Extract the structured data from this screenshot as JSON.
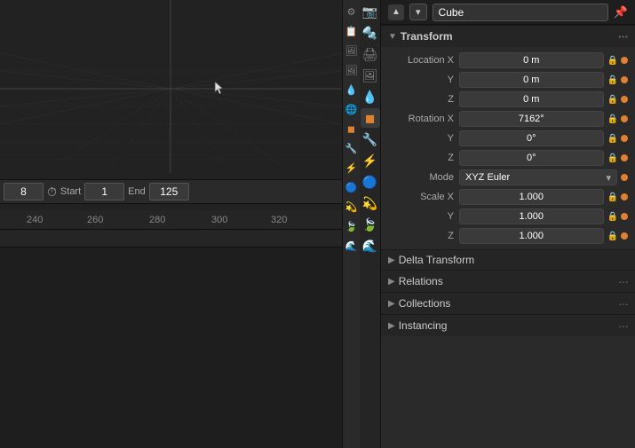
{
  "viewport": {
    "frame_current": "8",
    "timeline_start_label": "Start",
    "timeline_start_value": "1",
    "timeline_end_label": "End",
    "timeline_end_value": "125",
    "ruler_marks": [
      "240",
      "260",
      "280",
      "300",
      "320"
    ]
  },
  "properties": {
    "header": {
      "type_label": "Cube",
      "name_value": "Cube",
      "pin_symbol": "📌"
    },
    "transform_section": {
      "label": "Transform",
      "dots": "···"
    },
    "location": {
      "label_x": "Location X",
      "label_y": "Y",
      "label_z": "Z",
      "value_x": "0 m",
      "value_y": "0 m",
      "value_z": "0 m"
    },
    "rotation": {
      "label_x": "Rotation X",
      "label_y": "Y",
      "label_z": "Z",
      "value_x": "7162°",
      "value_y": "0°",
      "value_z": "0°",
      "mode_label": "Mode",
      "mode_value": "XYZ Euler",
      "mode_dots": "···"
    },
    "scale": {
      "label_x": "Scale X",
      "label_y": "Y",
      "label_z": "Z",
      "value_x": "1.000",
      "value_y": "1.000",
      "value_z": "1.000"
    },
    "delta_section": {
      "label": "Delta Transform",
      "chevron": "▶"
    },
    "relations_section": {
      "label": "Relations",
      "chevron": "▶",
      "dots": "···"
    },
    "collections_section": {
      "label": "Collections",
      "chevron": "▶",
      "dots": "···"
    },
    "instancing_section": {
      "label": "Instancing",
      "chevron": "▶",
      "dots": "···"
    }
  },
  "sidebar_icons": {
    "icons": [
      "⚙",
      "📋",
      "🖼",
      "🖼",
      "💧",
      "🌐",
      "📊",
      "🔧",
      "⚡",
      "🔵",
      "💫",
      "🍃",
      "🌐"
    ]
  },
  "prop_icons": {
    "icons": [
      "📋",
      "🔩",
      "📐",
      "💧",
      "✏️",
      "🔵",
      "🔧",
      "🌊",
      "💫",
      "🍃",
      "🌐"
    ]
  }
}
